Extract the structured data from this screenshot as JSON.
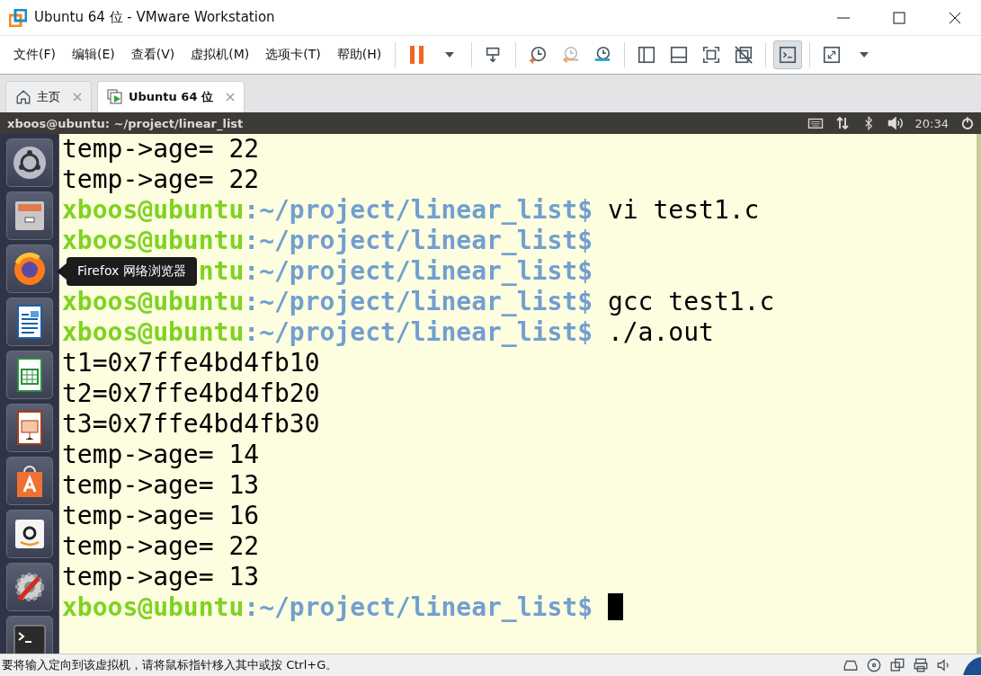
{
  "window": {
    "title": "Ubuntu 64 位 - VMware Workstation"
  },
  "menu": [
    "文件(F)",
    "编辑(E)",
    "查看(V)",
    "虚拟机(M)",
    "选项卡(T)",
    "帮助(H)"
  ],
  "toolbar": [
    [
      {
        "kind": "pause",
        "selected": false
      },
      {
        "kind": "dropdown",
        "selected": false
      }
    ],
    [
      {
        "kind": "send-keys",
        "selected": false
      }
    ],
    [
      {
        "kind": "snap-take",
        "selected": false
      },
      {
        "kind": "snap-revert",
        "selected": false
      },
      {
        "kind": "snap-manage",
        "selected": false
      }
    ],
    [
      {
        "kind": "library",
        "selected": false
      },
      {
        "kind": "thumbs",
        "selected": false
      },
      {
        "kind": "fullscreen",
        "selected": false
      },
      {
        "kind": "unity",
        "selected": false
      }
    ],
    [
      {
        "kind": "console",
        "selected": true
      }
    ],
    [
      {
        "kind": "stretch",
        "selected": false
      },
      {
        "kind": "dropdown",
        "selected": false
      }
    ]
  ],
  "tabs": [
    {
      "kind": "home",
      "label": "主页",
      "selected": false
    },
    {
      "kind": "vm",
      "label": "Ubuntu 64 位",
      "selected": true
    }
  ],
  "guest": {
    "top_bar": {
      "title": "xboos@ubuntu: ~/project/linear_list",
      "clock": "20:34"
    },
    "launcher": [
      {
        "kind": "dash"
      },
      {
        "kind": "files"
      },
      {
        "kind": "browser"
      },
      {
        "kind": "writer"
      },
      {
        "kind": "calc"
      },
      {
        "kind": "impress"
      },
      {
        "kind": "store"
      },
      {
        "kind": "amazon"
      },
      {
        "kind": "settings"
      },
      {
        "kind": "terminal"
      }
    ],
    "tooltip": "Firefox 网络浏览器",
    "terminal": {
      "lines": [
        {
          "kind": "output",
          "text": "temp->age= 22"
        },
        {
          "kind": "output",
          "text": "temp->age= 22"
        },
        {
          "kind": "prompt",
          "user": "xboos@ubuntu",
          "path": ":~/project/linear_list$",
          "command": "vi test1.c"
        },
        {
          "kind": "prompt",
          "user": "xboos@ubuntu",
          "path": ":~/project/linear_list$"
        },
        {
          "kind": "prompt-partial",
          "user": "ntu",
          "path": ":~/project/linear_list$"
        },
        {
          "kind": "prompt",
          "user": "xboos@ubuntu",
          "path": ":~/project/linear_list$",
          "command": "gcc test1.c"
        },
        {
          "kind": "prompt",
          "user": "xboos@ubuntu",
          "path": ":~/project/linear_list$",
          "command": "./a.out"
        },
        {
          "kind": "output",
          "text": "t1=0x7ffe4bd4fb10"
        },
        {
          "kind": "output",
          "text": "t2=0x7ffe4bd4fb20"
        },
        {
          "kind": "output",
          "text": "t3=0x7ffe4bd4fb30"
        },
        {
          "kind": "output",
          "text": "temp->age= 14"
        },
        {
          "kind": "output",
          "text": "temp->age= 13"
        },
        {
          "kind": "output",
          "text": "temp->age= 16"
        },
        {
          "kind": "output",
          "text": "temp->age= 22"
        },
        {
          "kind": "output",
          "text": "temp->age= 13"
        },
        {
          "kind": "prompt-cursor",
          "user": "xboos@ubuntu",
          "path": ":~/project/linear_list$"
        }
      ]
    }
  },
  "status_bar": {
    "message": "要将输入定向到该虚拟机，请将鼠标指针移入其中或按 Ctrl+G。"
  }
}
